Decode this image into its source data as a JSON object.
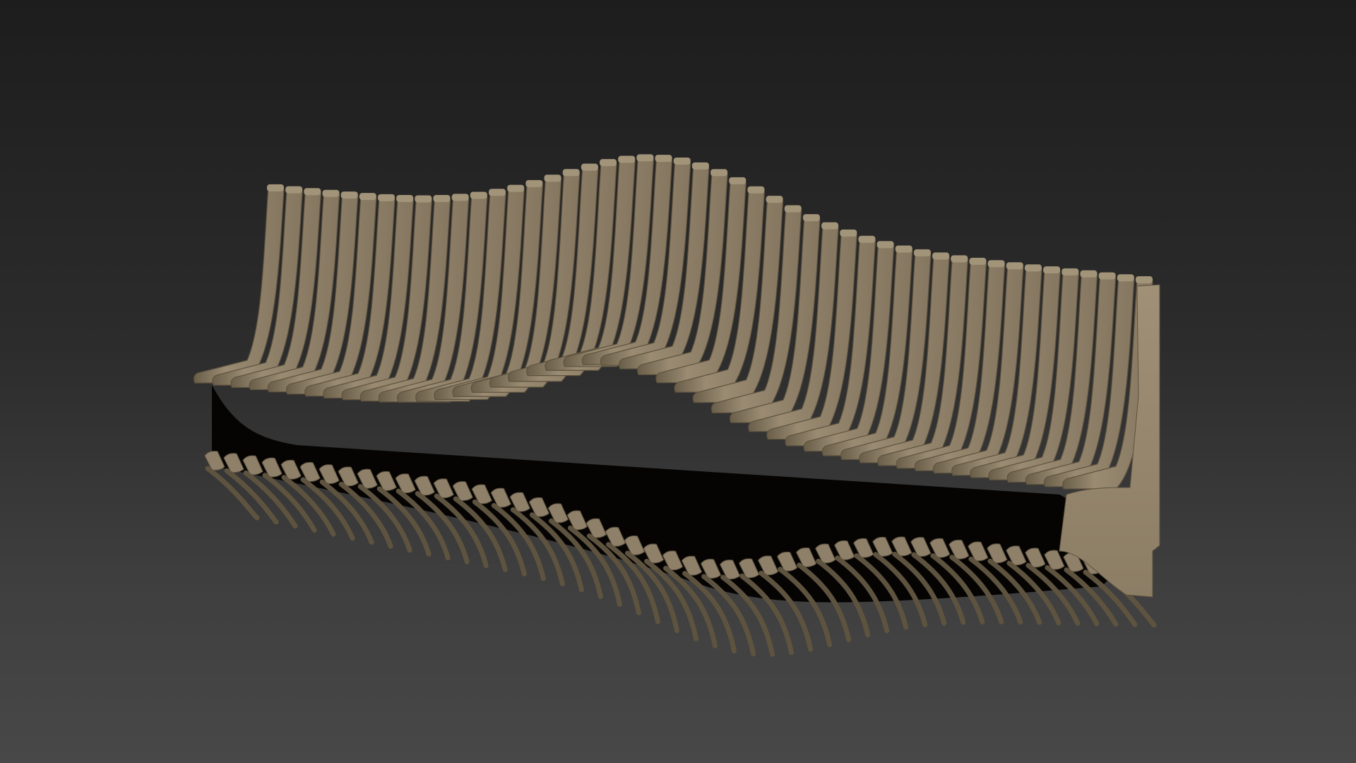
{
  "scene": {
    "subject": "parametric-slatted-bench",
    "colors": {
      "background_top": "#1d1d1d",
      "background_bottom": "#484848",
      "slat_face": "#8f806a",
      "slat_highlight": "#a29479",
      "slat_shadow": "#5e533f",
      "cavity": "#050403"
    },
    "slat_count": 48
  }
}
